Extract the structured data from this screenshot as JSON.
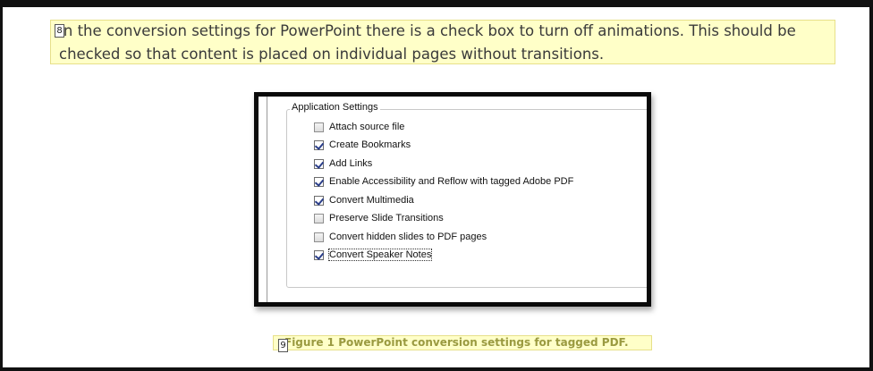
{
  "document": {
    "paragraph": "In the conversion settings for PowerPoint there is a check box to turn off animations. This should be\nchecked so that content is placed on individual pages without transitions.",
    "paragraph_tag": "8",
    "caption": "Figure 1 PowerPoint conversion settings for tagged PDF.",
    "caption_tag": "9"
  },
  "dialog": {
    "group_title": "Application Settings",
    "options": [
      {
        "label": "Attach source file",
        "checked": false
      },
      {
        "label": "Create Bookmarks",
        "checked": true
      },
      {
        "label": "Add Links",
        "checked": true
      },
      {
        "label": "Enable Accessibility and Reflow with tagged Adobe PDF",
        "checked": true
      },
      {
        "label": "Convert Multimedia",
        "checked": true
      },
      {
        "label": "Preserve Slide Transitions",
        "checked": false
      },
      {
        "label": "Convert hidden slides to PDF pages",
        "checked": false
      },
      {
        "label": "Convert Speaker Notes",
        "checked": true,
        "focused": true
      }
    ]
  },
  "colors": {
    "highlight": "#ffffc8",
    "frame": "#111111",
    "caption_text": "#9a9a40",
    "check_mark": "#2b3f8a"
  }
}
